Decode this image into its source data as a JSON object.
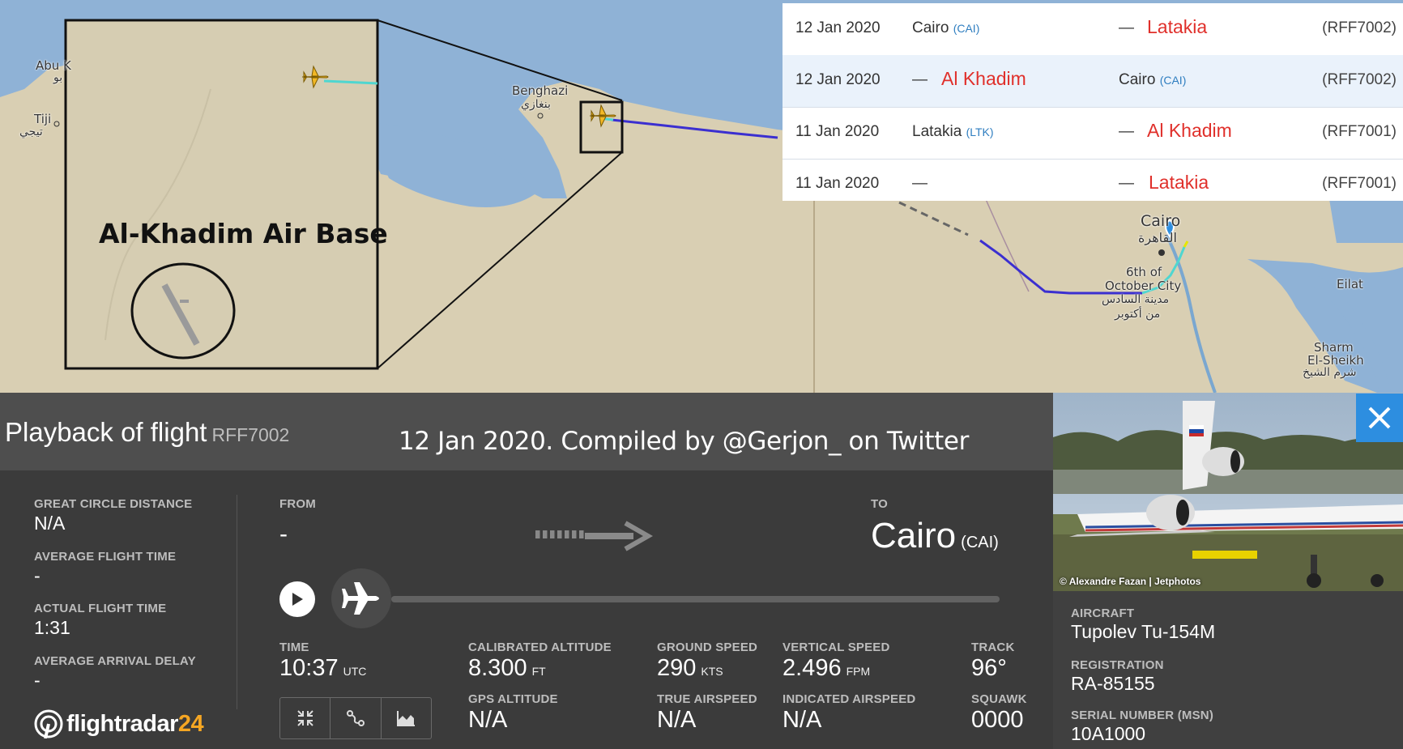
{
  "map": {
    "inset_title": "Al-Khadim Air Base",
    "labels": {
      "abu": "Abu K",
      "abu_ar": "بو",
      "tiji": "Tiji",
      "tiji_ar": "تيجي",
      "benghazi": "Benghazi",
      "benghazi_ar": "بنغازي",
      "cairo": "Cairo",
      "cairo_ar": "القاهرة",
      "sixth_october_1": "6th of",
      "sixth_october_2": "October City",
      "sixth_october_ar1": "مدينة السادس",
      "sixth_october_ar2": "من أكتوبر",
      "eilat": "Eilat",
      "sharm_1": "Sharm",
      "sharm_2": "El-Sheikh",
      "sharm_ar": "شرم الشيخ"
    }
  },
  "history": [
    {
      "date": "12 Jan 2020",
      "from": "Cairo",
      "from_code": "(CAI)",
      "to": "Latakia",
      "to_code": "",
      "flight": "(RFF7002)",
      "selected": false
    },
    {
      "date": "12 Jan 2020",
      "from": "Al Khadim",
      "from_code": "",
      "to": "Cairo",
      "to_code": "(CAI)",
      "flight": "(RFF7002)",
      "selected": true
    },
    {
      "date": "11 Jan 2020",
      "from": "Latakia",
      "from_code": "(LTK)",
      "to": "Al Khadim",
      "to_code": "",
      "flight": "(RFF7001)",
      "selected": false
    },
    {
      "date": "11 Jan 2020",
      "from": "—",
      "from_code": "",
      "to": "Latakia",
      "to_code": "",
      "flight": "(RFF7001)",
      "selected": false
    }
  ],
  "dash": "—",
  "panel": {
    "title": "Playback of flight",
    "flight": "RFF7002",
    "caption": "12 Jan 2020. Compiled by @Gerjon_ on Twitter",
    "stats": {
      "gcd_label": "GREAT CIRCLE DISTANCE",
      "gcd_value": "N/A",
      "aft_label": "AVERAGE FLIGHT TIME",
      "aft_value": "-",
      "act_label": "ACTUAL FLIGHT TIME",
      "act_value": "1:31",
      "aad_label": "AVERAGE ARRIVAL DELAY",
      "aad_value": "-"
    },
    "from_label": "FROM",
    "from_value": "-",
    "to_label": "TO",
    "to_city": "Cairo",
    "to_code": "(CAI)",
    "progress": 0.0,
    "metrics": {
      "time_label": "TIME",
      "time_value": "10:37",
      "time_unit": "UTC",
      "cal_alt_label": "CALIBRATED ALTITUDE",
      "cal_alt_value": "8.300",
      "cal_alt_unit": "FT",
      "gs_label": "GROUND SPEED",
      "gs_value": "290",
      "gs_unit": "KTS",
      "vs_label": "VERTICAL SPEED",
      "vs_value": "2.496",
      "vs_unit": "FPM",
      "track_label": "TRACK",
      "track_value": "96°",
      "gps_alt_label": "GPS ALTITUDE",
      "gps_alt_value": "N/A",
      "tas_label": "TRUE AIRSPEED",
      "tas_value": "N/A",
      "ias_label": "INDICATED AIRSPEED",
      "ias_value": "N/A",
      "squawk_label": "SQUAWK",
      "squawk_value": "0000"
    },
    "tools": [
      "expand-icon",
      "route-icon",
      "chart-icon"
    ],
    "brand": {
      "name": "flightradar",
      "num": "24"
    }
  },
  "aircraft": {
    "photo_credit": "© Alexandre Fazan | Jetphotos",
    "aircraft_label": "AIRCRAFT",
    "aircraft_value": "Tupolev Tu-154M",
    "reg_label": "REGISTRATION",
    "reg_value": "RA-85155",
    "msn_label": "SERIAL NUMBER (MSN)",
    "msn_value": "10A1000"
  },
  "colors": {
    "accent": "#2d8ee0",
    "brand_orange": "#f5a623",
    "history_red": "#e0302b",
    "code_blue": "#2f7ec0",
    "track_blue": "#3b2fd0",
    "track_cyan": "#4fd6d0"
  }
}
